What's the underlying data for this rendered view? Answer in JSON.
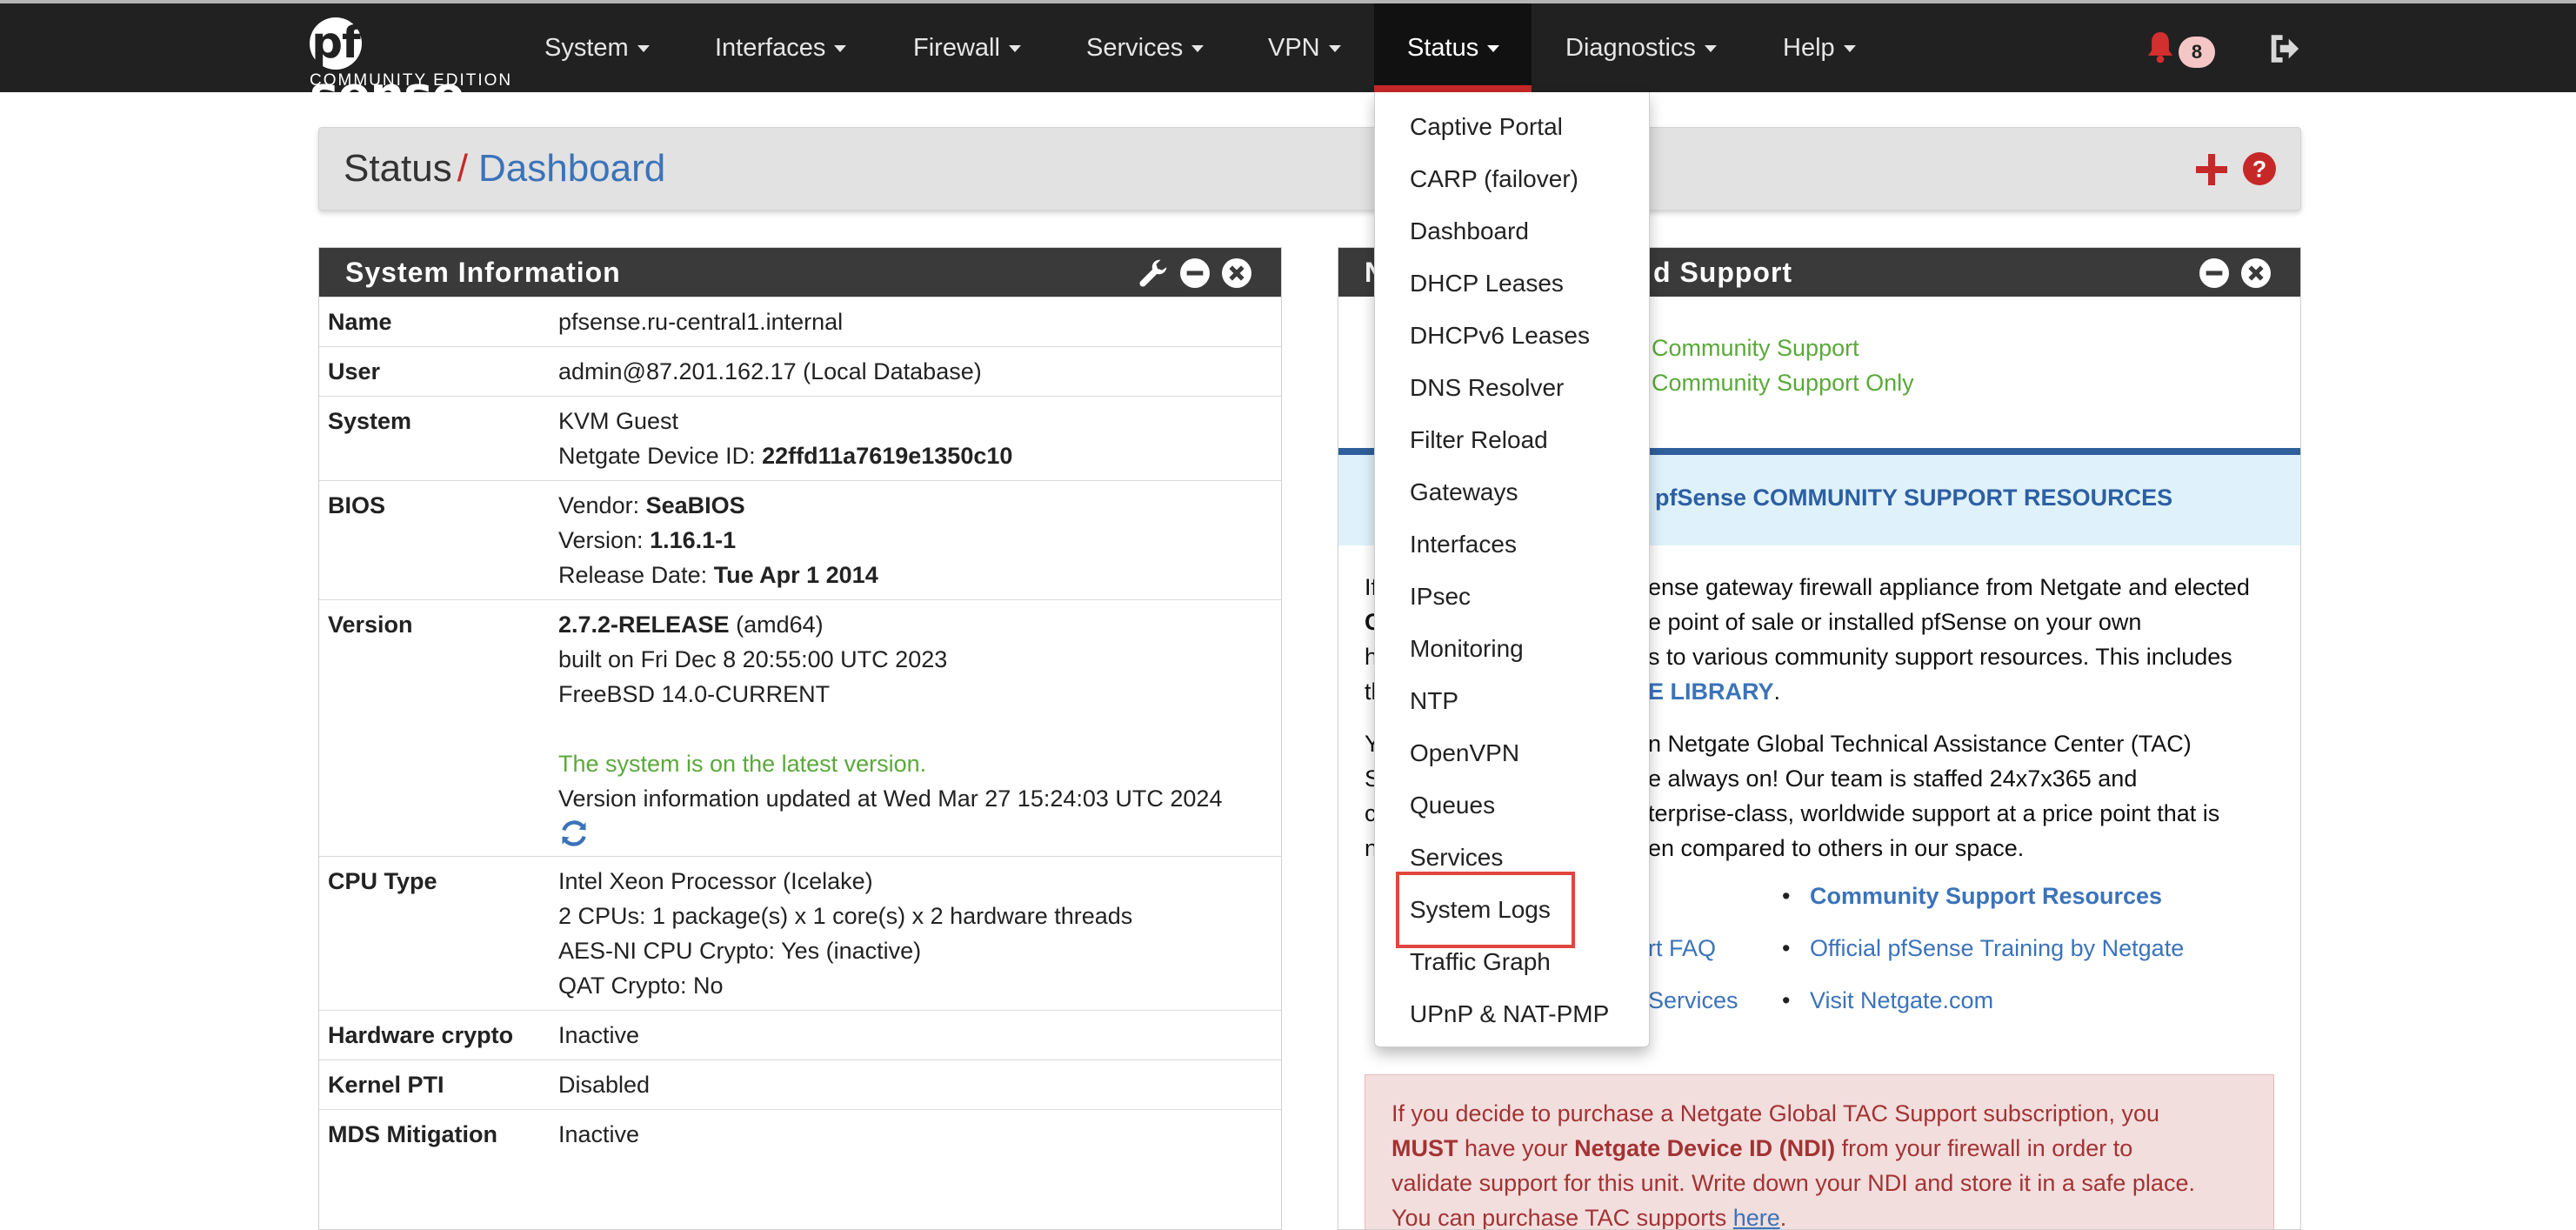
{
  "brand": {
    "logo_text": "sense",
    "logo_mark": "pf",
    "edition": "COMMUNITY EDITION"
  },
  "nav": {
    "items": [
      {
        "label": "System"
      },
      {
        "label": "Interfaces"
      },
      {
        "label": "Firewall"
      },
      {
        "label": "Services"
      },
      {
        "label": "VPN"
      },
      {
        "label": "Status"
      },
      {
        "label": "Diagnostics"
      },
      {
        "label": "Help"
      }
    ],
    "notifications_count": "8",
    "colors": {
      "bar": "#212121",
      "active_underline": "#c62828",
      "bell": "#d32f2f"
    }
  },
  "breadcrumb": {
    "section": "Status",
    "separator": "/",
    "page": "Dashboard"
  },
  "status_menu": {
    "items": [
      "Captive Portal",
      "CARP (failover)",
      "Dashboard",
      "DHCP Leases",
      "DHCPv6 Leases",
      "DNS Resolver",
      "Filter Reload",
      "Gateways",
      "Interfaces",
      "IPsec",
      "Monitoring",
      "NTP",
      "OpenVPN",
      "Queues",
      "Services",
      "System Logs",
      "Traffic Graph",
      "UPnP & NAT-PMP"
    ],
    "highlighted": "System Logs"
  },
  "system_info": {
    "title": "System Information",
    "name": {
      "label": "Name",
      "value": "pfsense.ru-central1.internal"
    },
    "user": {
      "label": "User",
      "value": "admin@87.201.162.17 (Local Database)"
    },
    "system": {
      "label": "System",
      "line1": "KVM Guest",
      "ndi_label": "Netgate Device ID:",
      "ndi_value": "22ffd11a7619e1350c10"
    },
    "bios": {
      "label": "BIOS",
      "vendor_label": "Vendor:",
      "vendor": "SeaBIOS",
      "version_label": "Version:",
      "version": "1.16.1-1",
      "release_label": "Release Date:",
      "release": "Tue Apr 1 2014"
    },
    "version": {
      "label": "Version",
      "release": "2.7.2-RELEASE",
      "arch": "(amd64)",
      "built": "built on Fri Dec 8 20:55:00 UTC 2023",
      "os": "FreeBSD 14.0-CURRENT",
      "status": "The system is on the latest version.",
      "updated": "Version information updated at Wed Mar 27 15:24:03 UTC 2024"
    },
    "cpu": {
      "label": "CPU Type",
      "line1": "Intel Xeon Processor (Icelake)",
      "line2": "2 CPUs: 1 package(s) x 1 core(s) x 2 hardware threads",
      "line3": "AES-NI CPU Crypto: Yes (inactive)",
      "line4": "QAT Crypto: No"
    },
    "hw_crypto": {
      "label": "Hardware crypto",
      "value": "Inactive"
    },
    "kernel_pti": {
      "label": "Kernel PTI",
      "value": "Disabled"
    },
    "mds": {
      "label": "MDS Mitigation",
      "value": "Inactive"
    }
  },
  "support_panel": {
    "title_left": "N",
    "title_right": "d Support",
    "line1": "Community Support",
    "line2": "Community Support Only",
    "banner": "pfSense COMMUNITY SUPPORT RESOURCES",
    "para1": [
      {
        "left": "If",
        "right": "ense gateway firewall appliance from Netgate and elected"
      },
      {
        "left": "C",
        "right": "e point of sale or installed pfSense on your own"
      },
      {
        "left": "h",
        "right": "s to various community support resources. This includes"
      },
      {
        "left": "th",
        "right": "E LIBRARY",
        "tail": "."
      }
    ],
    "para2": [
      {
        "left": "Y",
        "right": "n Netgate Global Technical Assistance Center (TAC)"
      },
      {
        "left": "S",
        "right": "e always on! Our team is staffed 24x7x365 and"
      },
      {
        "left": "c",
        "right": "terprise-class, worldwide support at a price point that is"
      },
      {
        "left": "n",
        "right": "en compared to others in our space."
      }
    ],
    "links_left": [
      "rt FAQ",
      "Services"
    ],
    "links_right": [
      "Community Support Resources",
      "Official pfSense Training by Netgate",
      "Visit Netgate.com"
    ],
    "alert": {
      "l1a": "If you decide to purchase a Netgate Global TAC Support subscription, you",
      "must": "MUST",
      "l2a": " have your ",
      "ndi": "Netgate Device ID (NDI)",
      "l2b": " from your firewall in order to",
      "l3": "validate support for this unit. Write down your NDI and store it in a safe place.",
      "l4": "You can purchase TAC supports ",
      "here": "here",
      "dot": "."
    }
  }
}
